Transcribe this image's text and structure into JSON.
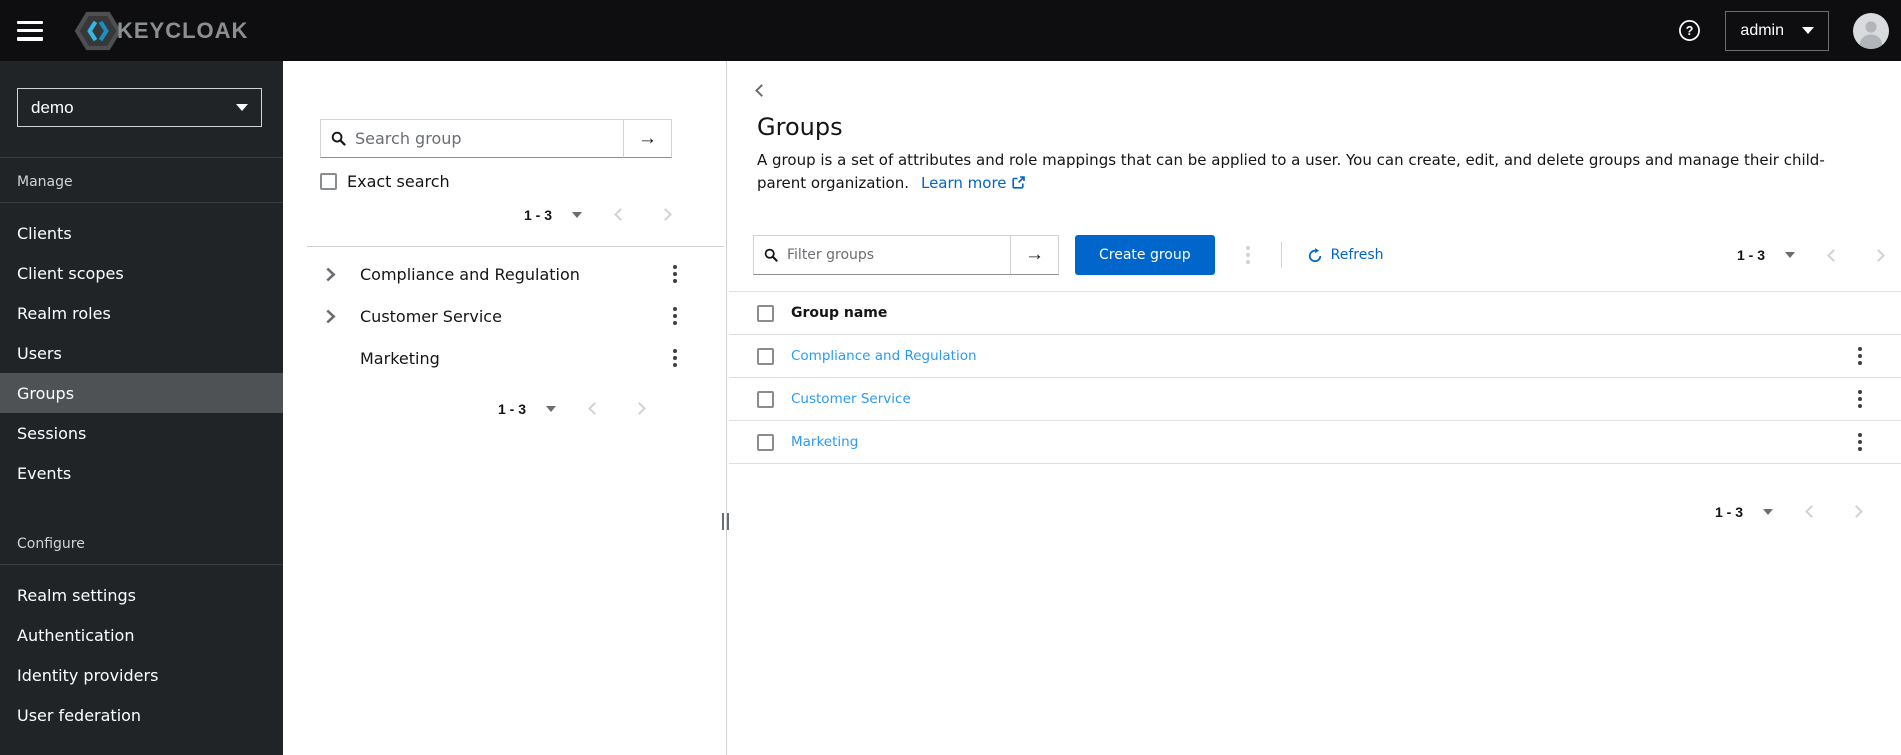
{
  "masthead": {
    "brand": "KEYCLOAK",
    "user": "admin"
  },
  "sidebar": {
    "realm": "demo",
    "sections": [
      {
        "label": "Manage",
        "items": [
          "Clients",
          "Client scopes",
          "Realm roles",
          "Users",
          "Groups",
          "Sessions",
          "Events"
        ]
      },
      {
        "label": "Configure",
        "items": [
          "Realm settings",
          "Authentication",
          "Identity providers",
          "User federation"
        ]
      }
    ],
    "selected_item": "Groups"
  },
  "tree_panel": {
    "search_placeholder": "Search group",
    "exact_search_label": "Exact search",
    "top_pagination": {
      "range": "1 - 3"
    },
    "items": [
      {
        "label": "Compliance and Regulation",
        "expandable": true
      },
      {
        "label": "Customer Service",
        "expandable": true
      },
      {
        "label": "Marketing",
        "expandable": false
      }
    ],
    "bottom_pagination": {
      "range": "1 - 3"
    }
  },
  "main": {
    "title": "Groups",
    "description": "A group is a set of attributes and role mappings that can be applied to a user. You can create, edit, and delete groups and manage their child-parent organization.",
    "learn_more_label": "Learn more",
    "toolbar": {
      "filter_placeholder": "Filter groups",
      "create_button_label": "Create group",
      "refresh_label": "Refresh",
      "pagination": {
        "range": "1 - 3"
      }
    },
    "table": {
      "columns": [
        "Group name"
      ],
      "rows": [
        {
          "name": "Compliance and Regulation"
        },
        {
          "name": "Customer Service"
        },
        {
          "name": "Marketing"
        }
      ]
    },
    "bottom_pagination": {
      "range": "1 - 3"
    }
  },
  "colors": {
    "accent_blue": "#0066cc",
    "table_link_blue": "#2b9af3",
    "masthead_bg": "#0e0e10",
    "sidebar_bg": "#212427",
    "sidebar_selected_bg": "#4f5255",
    "logo_cyan": "#35b7e4",
    "border_gray": "#d2d2d2"
  },
  "icons": {
    "hamburger-icon": "three horizontal bars",
    "keycloak-logo-icon": "gray hexagon with cyan chevrons",
    "help-icon": "question mark in circle",
    "avatar-icon": "person silhouette in circle",
    "search-icon": "magnifier",
    "arrow-right-icon": "→",
    "kebab-icon": "⋮",
    "refresh-icon": "circular arrow",
    "external-link-icon": "box with arrow",
    "chevron-right-icon": "›",
    "caret-down-icon": "▾"
  }
}
